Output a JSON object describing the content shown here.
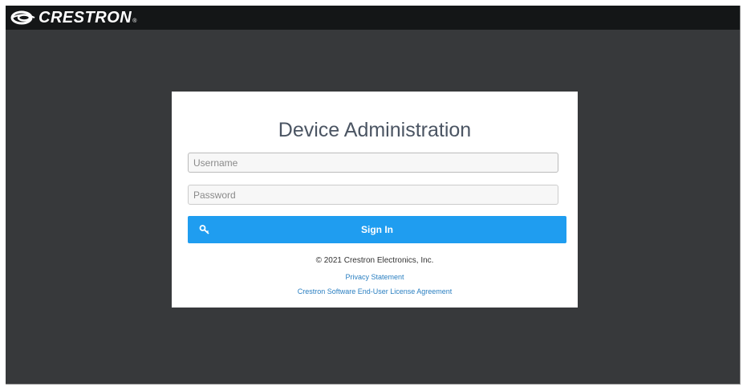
{
  "header": {
    "brand_name": "CRESTRON",
    "brand_registered": "®",
    "logo_icon": "crestron-swirl-icon"
  },
  "login": {
    "title": "Device Administration",
    "username_placeholder": "Username",
    "password_placeholder": "Password",
    "sign_in_label": "Sign In",
    "sign_in_icon": "key-icon",
    "copyright": "© 2021 Crestron Electronics, Inc.",
    "privacy_link": "Privacy Statement",
    "eula_link": "Crestron Software End-User License Agreement"
  },
  "colors": {
    "background": "#37393b",
    "topbar": "#141617",
    "accent": "#1f9df0",
    "link": "#2a7fc1"
  }
}
